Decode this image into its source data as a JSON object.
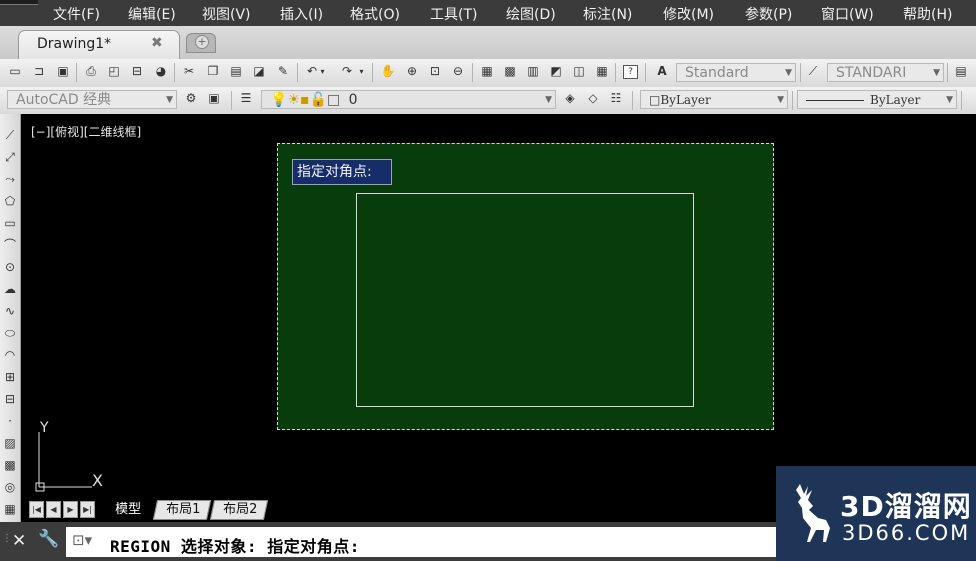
{
  "menu": {
    "items": [
      "文件(F)",
      "编辑(E)",
      "视图(V)",
      "插入(I)",
      "格式(O)",
      "工具(T)",
      "绘图(D)",
      "标注(N)",
      "修改(M)",
      "参数(P)",
      "窗口(W)",
      "帮助(H)"
    ]
  },
  "tabs": {
    "document_title": "Drawing1*",
    "close_glyph": "✖",
    "new_glyph": "+"
  },
  "toolbar1": {
    "text_style": "Standard",
    "dim_style": "STANDARI"
  },
  "toolbar2": {
    "workspace": "AutoCAD 经典",
    "layer": "0",
    "color": "ByLayer",
    "linetype": "ByLayer"
  },
  "viewport": {
    "label": "[−][俯视][二维线框]",
    "ucs_y": "Y",
    "ucs_x": "X"
  },
  "tooltip": {
    "prompt": "指定对角点:"
  },
  "layout_tabs": [
    "模型",
    "布局1",
    "布局2"
  ],
  "command_line": {
    "text": "REGION 选择对象: 指定对角点:"
  },
  "watermark": {
    "brand": "3D溜溜网",
    "url": "3D66.COM"
  },
  "colors": {
    "selection_fill": "#083c0c",
    "tooltip_bg": "#172d6a",
    "watermark_bg": "#1f3558"
  }
}
